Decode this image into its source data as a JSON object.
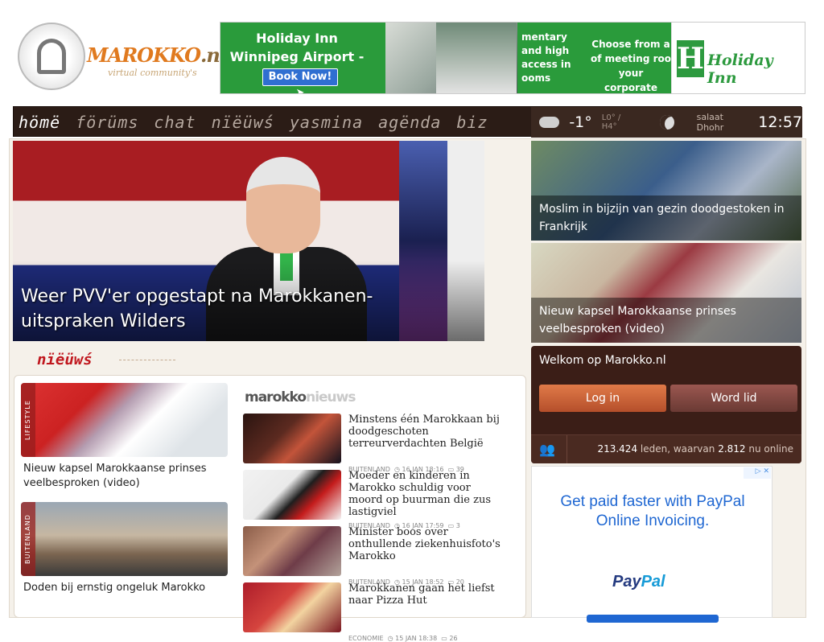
{
  "header": {
    "logo_name": "MAROKKO",
    "logo_tld": ".nl",
    "logo_tagline": "virtual community's"
  },
  "ad_banner": {
    "headline": "Holiday Inn Winnipeg Airport - Polo Park",
    "button": "Book Now! ➤",
    "mid_text": "mentary and high access in ooms",
    "mid_text2": "Choose from a of meeting roo your corporate",
    "brand": "Holiday Inn",
    "brand_letter": "H"
  },
  "nav": {
    "items": [
      "hömë",
      "förüms",
      "chat",
      "nïëüwś",
      "yasmina",
      "agënda",
      "biz"
    ],
    "weather_temp": "-1°",
    "weather_lohi": "L0° / H4°",
    "prayer_label": "salaat Dhohr",
    "prayer_time": "12:57"
  },
  "hero": {
    "caption": "Weer PVV'er opgestapt na Marokkanen-uitspraken Wilders"
  },
  "side_stories": [
    {
      "caption": "Moslim in bijzijn van gezin doodgestoken in Frankrijk"
    },
    {
      "caption": "Nieuw kapsel Marokkaanse prinses veelbesproken (video)"
    }
  ],
  "section": {
    "title": "nïëüwś"
  },
  "cards": [
    {
      "label": "LIFESTYLE",
      "title": "Nieuw kapsel Marokkaanse prinses veelbesproken (video)"
    },
    {
      "label": "BUITENLAND",
      "title": "Doden bij ernstig ongeluk Marokko"
    }
  ],
  "marokkonieuws": {
    "logo_a": "marokko",
    "logo_b": "nieuws",
    "items": [
      {
        "title": "Minstens één Marokkaan bij doodgeschoten terreurverdachten België",
        "category": "BUITENLAND",
        "date": "16 JAN 18:16",
        "comments": "39"
      },
      {
        "title": "Moeder en kinderen in Marokko schuldig voor moord op buurman die zus lastigviel",
        "category": "BUITENLAND",
        "date": "16 JAN 17:59",
        "comments": "3"
      },
      {
        "title": "Minister boos over onthullende ziekenhuisfoto's Marokko",
        "category": "BUITENLAND",
        "date": "15 JAN 18:52",
        "comments": "20"
      },
      {
        "title": "Marokkanen gaan het liefst naar Pizza Hut",
        "category": "ECONOMIE",
        "date": "15 JAN 18:38",
        "comments": "26"
      }
    ]
  },
  "welcome": {
    "title": "Welkom op Marokko.nl",
    "login": "Log in",
    "register": "Word lid",
    "members": "213.424",
    "members_text": " leden, waarvan ",
    "online": "2.812",
    "online_text": " nu online"
  },
  "paypal_ad": {
    "text": "Get paid faster with PayPal Online Invoicing.",
    "logo_a": "Pay",
    "logo_b": "Pal",
    "adchoices": "▷ ✕"
  }
}
